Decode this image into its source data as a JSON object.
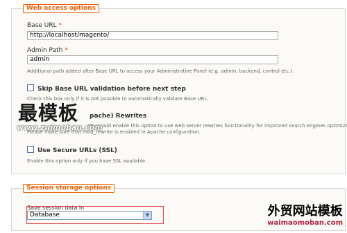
{
  "web_access": {
    "legend": "Web access options",
    "base_url": {
      "label": "Base URL",
      "required": "*",
      "value": "http://localhost/magento/"
    },
    "admin_path": {
      "label": "Admin Path",
      "required": "*",
      "value": "admin",
      "note": "Additional path added after Base URL to access your Administrative Panel (e.g. admin, backend, control etc.)."
    },
    "skip_validation": {
      "label": "Skip Base URL validation before next step",
      "note": "Check this box only if it is not possible to automatically validate Base URL."
    },
    "web_server_rewrites": {
      "label": "pache) Rewrites",
      "note_line1": "You could enable this option to use web server rewrites functionality for improved search engines optimization.",
      "note_line2": "Please make sure that mod_rewrite is enabled in Apache configuration."
    },
    "secure_urls": {
      "label": "Use Secure URLs (SSL)",
      "note": "Enable this option only if you have SSL available."
    }
  },
  "session_storage": {
    "legend": "Session storage options",
    "save_label": "Save session data in",
    "selected": "Database"
  },
  "watermarks": {
    "big": "最模板",
    "url": "www.zuimoban.com",
    "right_cn": "外贸网站模板",
    "right_en": "waimaomoban.com"
  },
  "colors": {
    "accent": "#eb5e00",
    "highlight_box": "#e04a4a"
  }
}
